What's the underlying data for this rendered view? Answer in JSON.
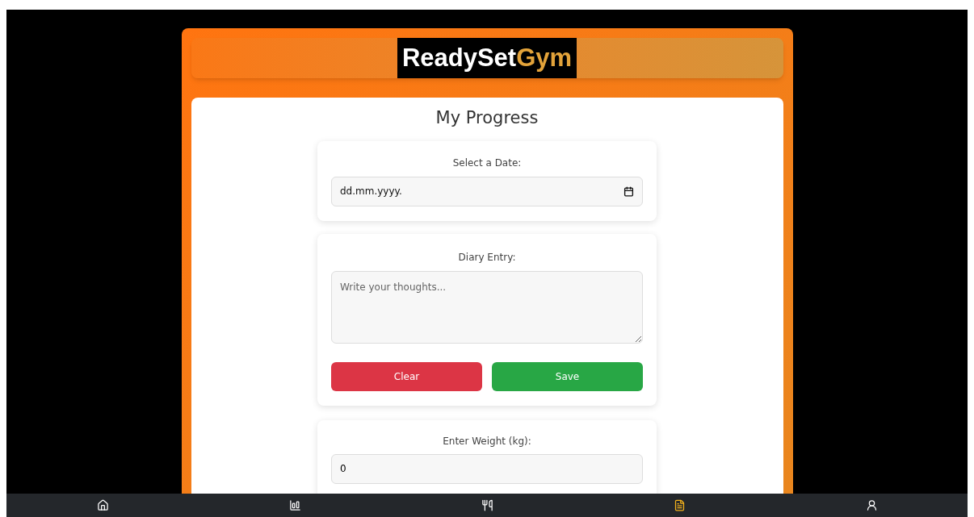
{
  "brand": {
    "part_1": "ReadySet",
    "part_2": "Gym"
  },
  "page_title": "My Progress",
  "date_section": {
    "label": "Select a Date:",
    "placeholder": "dd.mm.yyyy."
  },
  "diary_section": {
    "label": "Diary Entry:",
    "placeholder": "Write your thoughts...",
    "buttons": [
      {
        "kind": "clear",
        "label": "Clear"
      },
      {
        "kind": "save",
        "label": "Save"
      }
    ]
  },
  "weight_section": {
    "label": "Enter Weight (kg):",
    "value": "0"
  },
  "bottom_nav": [
    {
      "kind": "home",
      "selected": false
    },
    {
      "kind": "chart",
      "selected": false
    },
    {
      "kind": "food",
      "selected": false
    },
    {
      "kind": "diary",
      "selected": true
    },
    {
      "kind": "profile",
      "selected": false
    }
  ]
}
